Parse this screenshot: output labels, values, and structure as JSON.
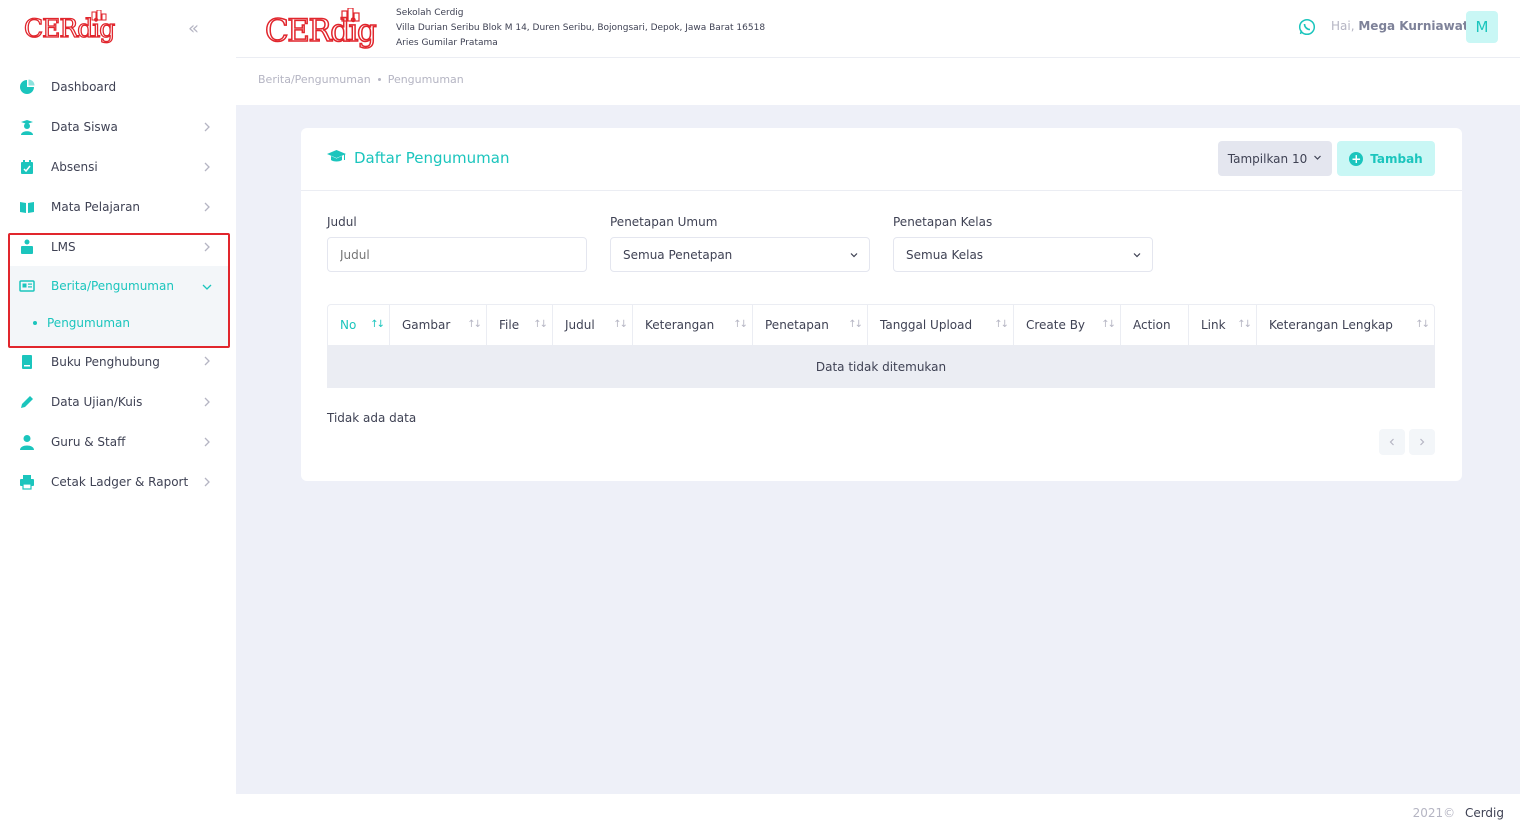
{
  "brand": {
    "logo_text": "CERdig",
    "logo_color": "#e1262d"
  },
  "school": {
    "name": "Sekolah Cerdig",
    "address": "Villa Durian Seribu Blok M 14, Duren Seribu, Bojongsari, Depok, Jawa Barat 16518",
    "person": "Aries Gumilar Pratama"
  },
  "user": {
    "greeting": "Hai,",
    "name": "Mega Kurniawati",
    "initial": "M"
  },
  "sidebar": {
    "items": [
      {
        "label": "Dashboard",
        "icon": "dashboard-icon"
      },
      {
        "label": "Data Siswa",
        "icon": "student-icon"
      },
      {
        "label": "Absensi",
        "icon": "calendar-check-icon"
      },
      {
        "label": "Mata Pelajaran",
        "icon": "book-open-icon"
      },
      {
        "label": "LMS",
        "icon": "lms-icon"
      },
      {
        "label": "Berita/Pengumuman",
        "icon": "newspaper-icon"
      },
      {
        "label": "Buku Penghubung",
        "icon": "book-icon"
      },
      {
        "label": "Data Ujian/Kuis",
        "icon": "pencil-icon"
      },
      {
        "label": "Guru & Staff",
        "icon": "user-tie-icon"
      },
      {
        "label": "Cetak Ladger & Raport",
        "icon": "printer-icon"
      }
    ],
    "subitem": "Pengumuman"
  },
  "breadcrumb": {
    "parent": "Berita/Pengumuman",
    "current": "Pengumuman"
  },
  "card": {
    "title": "Daftar Pengumuman",
    "show_button": "Tampilkan 10",
    "add_button": "Tambah"
  },
  "filters": {
    "judul_label": "Judul",
    "judul_placeholder": "Judul",
    "umum_label": "Penetapan Umum",
    "umum_value": "Semua Penetapan",
    "kelas_label": "Penetapan Kelas",
    "kelas_value": "Semua Kelas"
  },
  "table": {
    "columns": [
      "No",
      "Gambar",
      "File",
      "Judul",
      "Keterangan",
      "Penetapan",
      "Tanggal Upload",
      "Create By",
      "Action",
      "Link",
      "Keterangan Lengkap"
    ],
    "empty_message": "Data tidak ditemukan",
    "no_data": "Tidak ada data"
  },
  "footer": {
    "year": "2021©",
    "brand": "Cerdig"
  },
  "colors": {
    "accent": "#1bc5bd",
    "highlight": "#e1262d",
    "background": "#eef0f8"
  }
}
